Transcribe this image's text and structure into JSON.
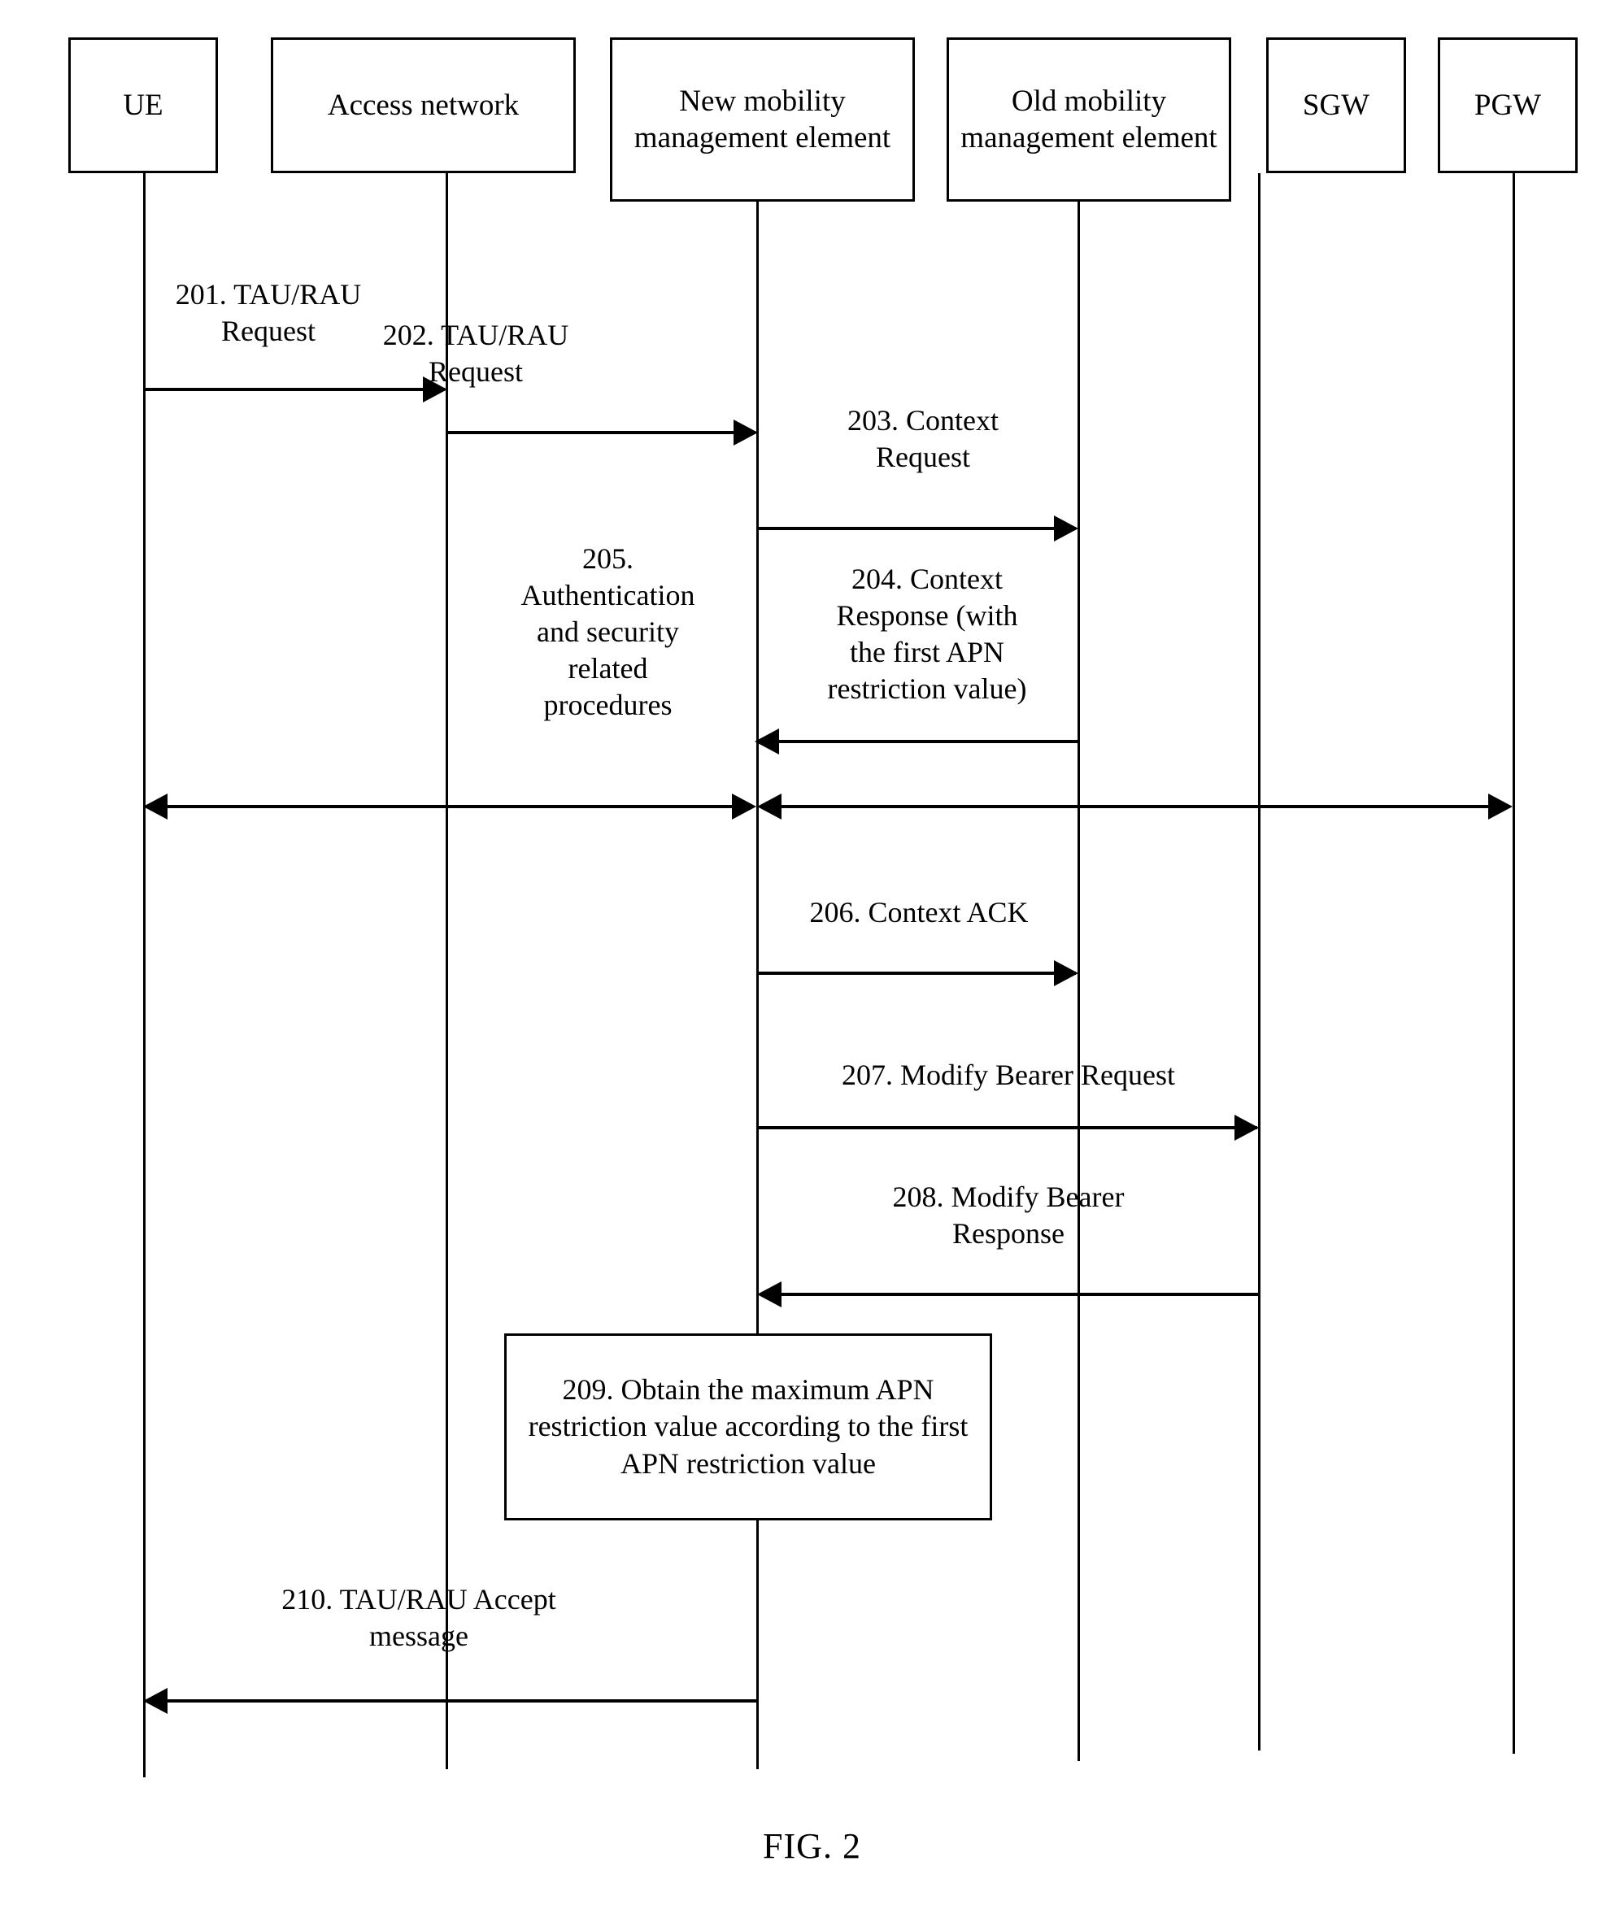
{
  "figure": {
    "caption": "FIG. 2",
    "type": "sequence-diagram"
  },
  "actors": [
    {
      "id": "ue",
      "label": "UE"
    },
    {
      "id": "access-network",
      "label": "Access\nnetwork"
    },
    {
      "id": "new-mme",
      "label": "New mobility\nmanagement\nelement"
    },
    {
      "id": "old-mme",
      "label": "Old mobility\nmanagement\nelement"
    },
    {
      "id": "sgw",
      "label": "SGW"
    },
    {
      "id": "pgw",
      "label": "PGW"
    }
  ],
  "messages": [
    {
      "id": "201",
      "label": "201. TAU/RAU\nRequest",
      "from": "ue",
      "to": "access-network",
      "direction": "right"
    },
    {
      "id": "202",
      "label": "202. TAU/RAU\nRequest",
      "from": "access-network",
      "to": "new-mme",
      "direction": "right"
    },
    {
      "id": "203",
      "label": "203. Context\nRequest",
      "from": "new-mme",
      "to": "old-mme",
      "direction": "right"
    },
    {
      "id": "204",
      "label": "204. Context\nResponse (with\nthe first APN\nrestriction value)",
      "from": "old-mme",
      "to": "new-mme",
      "direction": "left"
    },
    {
      "id": "205",
      "label": "205.\nAuthentication\nand security\nrelated\nprocedures",
      "from": "ue",
      "to": "pgw",
      "direction": "both"
    },
    {
      "id": "206",
      "label": "206. Context ACK",
      "from": "new-mme",
      "to": "old-mme",
      "direction": "right"
    },
    {
      "id": "207",
      "label": "207. Modify Bearer Request",
      "from": "new-mme",
      "to": "sgw",
      "direction": "right"
    },
    {
      "id": "208",
      "label": "208. Modify Bearer\nResponse",
      "from": "sgw",
      "to": "new-mme",
      "direction": "left"
    },
    {
      "id": "210",
      "label": "210. TAU/RAU Accept\nmessage",
      "from": "new-mme",
      "to": "ue",
      "direction": "left"
    }
  ],
  "notes": [
    {
      "id": "209",
      "label": "209. Obtain the maximum\nAPN restriction value\naccording to the first APN\nrestriction value",
      "attached_to": "new-mme"
    }
  ],
  "colors": {
    "line": "#000000",
    "background": "#ffffff",
    "text": "#000000"
  }
}
